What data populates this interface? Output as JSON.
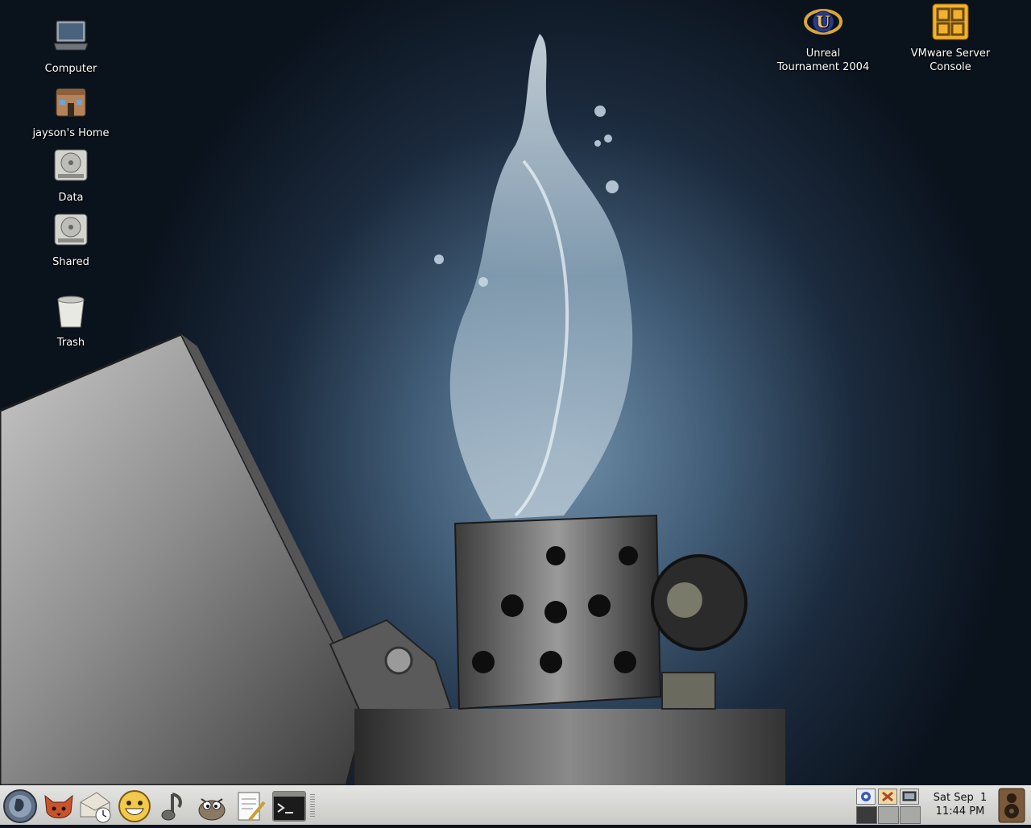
{
  "desktop": {
    "icons_left": [
      {
        "label": "Computer",
        "icon": "computer-icon"
      },
      {
        "label": "jayson's Home",
        "icon": "home-folder-icon"
      },
      {
        "label": "Data",
        "icon": "hard-drive-icon"
      },
      {
        "label": "Shared",
        "icon": "hard-drive-icon"
      },
      {
        "label": "Trash",
        "icon": "trash-icon"
      }
    ],
    "icons_right": [
      {
        "label": "Unreal Tournament 2004",
        "icon": "unreal-tournament-icon"
      },
      {
        "label": "VMware Server Console",
        "icon": "vmware-icon"
      }
    ]
  },
  "panel": {
    "launchers": [
      {
        "name": "gnome-menu-foot-icon"
      },
      {
        "name": "firefox-icon"
      },
      {
        "name": "evolution-mail-icon"
      },
      {
        "name": "gaim-icon"
      },
      {
        "name": "music-player-icon"
      },
      {
        "name": "gimp-icon"
      },
      {
        "name": "text-editor-icon"
      },
      {
        "name": "terminal-icon"
      }
    ],
    "clock": {
      "date": "Sat Sep  1",
      "time": "11:44 PM"
    }
  },
  "colors": {
    "panel_bg": "#d6d6d3",
    "desktop_text": "#ffffff"
  }
}
